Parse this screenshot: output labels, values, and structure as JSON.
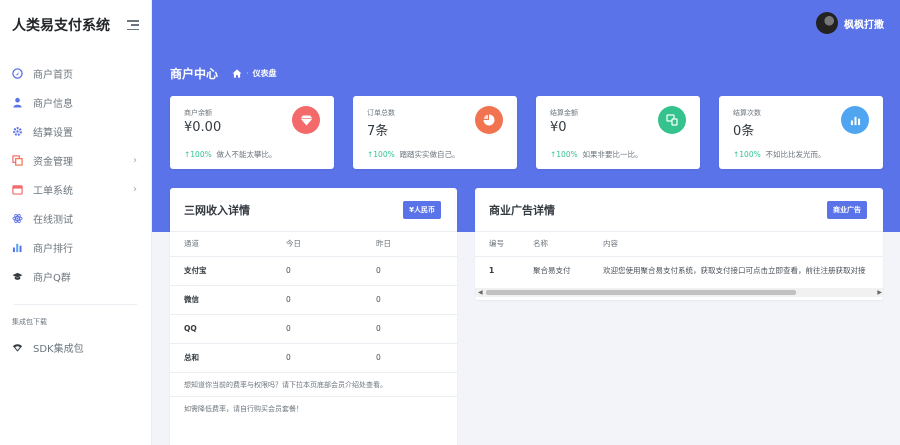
{
  "brand": {
    "title": "人类易支付系统"
  },
  "sidebar": {
    "items": [
      {
        "label": "商户首页",
        "icon": "dashboard-icon",
        "chevron": ""
      },
      {
        "label": "商户信息",
        "icon": "user-icon",
        "chevron": ""
      },
      {
        "label": "结算设置",
        "icon": "gear-icon",
        "chevron": ""
      },
      {
        "label": "资金管理",
        "icon": "copy-icon",
        "chevron": "›"
      },
      {
        "label": "工单系统",
        "icon": "calendar-icon",
        "chevron": "›"
      },
      {
        "label": "在线测试",
        "icon": "atom-icon",
        "chevron": ""
      },
      {
        "label": "商户排行",
        "icon": "bar-chart-icon",
        "chevron": ""
      },
      {
        "label": "商户Q群",
        "icon": "graduation-cap-icon",
        "chevron": ""
      }
    ],
    "section_label": "集成包下载",
    "sdk_item": {
      "label": "SDK集成包",
      "icon": "wifi-icon"
    }
  },
  "topbar": {
    "username": "枫枫打撒"
  },
  "page": {
    "title": "商户中心",
    "breadcrumb": "仪表盘"
  },
  "stats": [
    {
      "label": "商户余额",
      "value": "¥0.00",
      "pct": "↑100%",
      "note": "做人不能太攀比。",
      "color": "#f46a6a",
      "icon": "diamond-icon"
    },
    {
      "label": "订单总数",
      "value": "7条",
      "pct": "↑100%",
      "note": "踏踏实实做自己。",
      "color": "#f1734f",
      "icon": "pie-chart-icon"
    },
    {
      "label": "结算金额",
      "value": "¥0",
      "pct": "↑100%",
      "note": "如果非要比一比。",
      "color": "#34c38f",
      "icon": "device-icon"
    },
    {
      "label": "结算次数",
      "value": "0条",
      "pct": "↑100%",
      "note": "不如比比发光而。",
      "color": "#50a5f1",
      "icon": "bar-chart-icon"
    }
  ],
  "income": {
    "title": "三网收入详情",
    "badge": "¥人民币",
    "headers": [
      "通道",
      "今日",
      "昨日"
    ],
    "rows": [
      [
        "支付宝",
        "0",
        "0"
      ],
      [
        "微信",
        "0",
        "0"
      ],
      [
        "QQ",
        "0",
        "0"
      ],
      [
        "总和",
        "0",
        "0"
      ]
    ],
    "notes": [
      "想知道你当前的费率与权限吗？请下拉本页底部会员介绍处查看。",
      "如需降低费率，请自行购买会员套餐！"
    ]
  },
  "ads": {
    "title": "商业广告详情",
    "badge": "商业广告",
    "headers": [
      "编号",
      "名称",
      "内容"
    ],
    "rows": [
      [
        "1",
        "聚合易支付",
        "欢迎您使用聚合易支付系统，获取支付接口可点击立即查看，前往注册获取对接"
      ]
    ]
  },
  "colors": {
    "accent": "#5b73e8",
    "success": "#34c38f"
  }
}
